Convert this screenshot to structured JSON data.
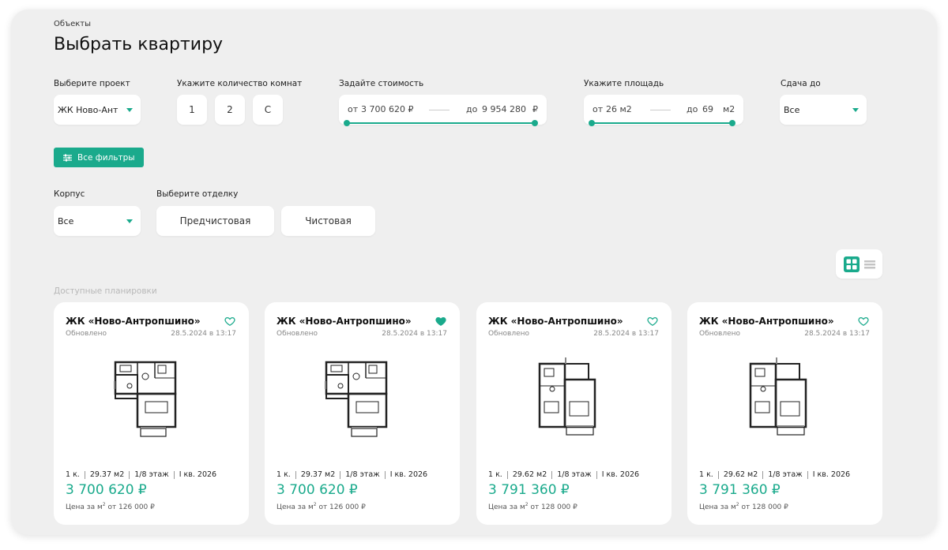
{
  "breadcrumb": "Объекты",
  "title": "Выбрать квартиру",
  "filters": {
    "project": {
      "label": "Выберите проект",
      "value": "ЖК Ново-Ант"
    },
    "rooms": {
      "label": "Укажите количество комнат",
      "options": [
        "1",
        "2",
        "С"
      ]
    },
    "price": {
      "label": "Задайте стоимость",
      "from_prefix": "от",
      "from_value": "3 700 620 ₽",
      "to_prefix": "до",
      "to_value": "9 954 280",
      "currency": "₽"
    },
    "area": {
      "label": "Укажите площадь",
      "from_prefix": "от",
      "from_value": "26 м2",
      "to_prefix": "до",
      "to_value": "69",
      "unit": "м2"
    },
    "delivery": {
      "label": "Сдача до",
      "value": "Все"
    },
    "all_filters_label": "Все фильтры",
    "building": {
      "label": "Корпус",
      "value": "Все"
    },
    "finish": {
      "label": "Выберите отделку",
      "options": [
        "Предчистовая",
        "Чистовая"
      ]
    }
  },
  "view_toggle": {
    "active": "grid"
  },
  "section_label": "Доступные планировки",
  "colors": {
    "accent": "#1aaa8c",
    "background": "#efefef"
  },
  "cards": [
    {
      "title": "ЖК «Ново-Антропшино»",
      "updated_label": "Обновлено",
      "updated_at": "28.5.2024 в 13:17",
      "rooms": "1 к.",
      "area": "29.37 м2",
      "floor": "1/8 этаж",
      "deadline": "I кв. 2026",
      "price": "3 700 620 ₽",
      "price_per_m2_prefix": "Цена за м",
      "price_per_m2_sup": "2",
      "price_per_m2_value": " от 126 000 ₽",
      "favorite": false
    },
    {
      "title": "ЖК «Ново-Антропшино»",
      "updated_label": "Обновлено",
      "updated_at": "28.5.2024 в 13:17",
      "rooms": "1 к.",
      "area": "29.37 м2",
      "floor": "1/8 этаж",
      "deadline": "I кв. 2026",
      "price": "3 700 620 ₽",
      "price_per_m2_prefix": "Цена за м",
      "price_per_m2_sup": "2",
      "price_per_m2_value": " от 126 000 ₽",
      "favorite": true
    },
    {
      "title": "ЖК «Ново-Антропшино»",
      "updated_label": "Обновлено",
      "updated_at": "28.5.2024 в 13:17",
      "rooms": "1 к.",
      "area": "29.62 м2",
      "floor": "1/8 этаж",
      "deadline": "I кв. 2026",
      "price": "3 791 360 ₽",
      "price_per_m2_prefix": "Цена за м",
      "price_per_m2_sup": "2",
      "price_per_m2_value": " от 128 000 ₽",
      "favorite": false
    },
    {
      "title": "ЖК «Ново-Антропшино»",
      "updated_label": "Обновлено",
      "updated_at": "28.5.2024 в 13:17",
      "rooms": "1 к.",
      "area": "29.62 м2",
      "floor": "1/8 этаж",
      "deadline": "I кв. 2026",
      "price": "3 791 360 ₽",
      "price_per_m2_prefix": "Цена за м",
      "price_per_m2_sup": "2",
      "price_per_m2_value": " от 128 000 ₽",
      "favorite": false
    }
  ]
}
